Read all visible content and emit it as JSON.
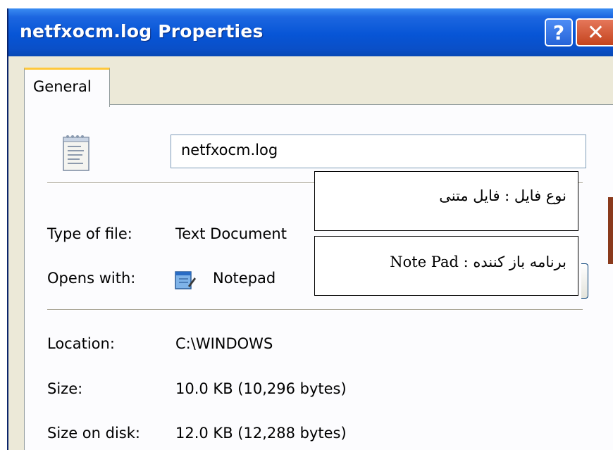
{
  "window": {
    "title": "netfxocm.log Properties",
    "help_label": "?",
    "close_label": "✕"
  },
  "tabs": [
    {
      "label": "General",
      "selected": true
    }
  ],
  "general": {
    "file_icon": "text-document-icon",
    "file_name": "netfxocm.log",
    "type_label": "Type of file:",
    "type_value": "Text Document",
    "opens_label": "Opens with:",
    "opens_icon": "notepad-icon",
    "opens_value": "Notepad",
    "location_label": "Location:",
    "location_value": "C:\\WINDOWS",
    "size_label": "Size:",
    "size_value": "10.0 KB (10,296 bytes)",
    "size_on_disk_label": "Size on disk:",
    "size_on_disk_value": "12.0 KB (12,288 bytes)"
  },
  "annotations": {
    "file_type_note": "نوع فایل : فایل متنی",
    "opens_with_note": "برنامه باز کننده : Note Pad"
  },
  "colors": {
    "titlebar": "#0755d6",
    "tab_highlight": "#ffc83c",
    "close_button": "#c4441e",
    "dialog_background": "#ece9d8"
  }
}
